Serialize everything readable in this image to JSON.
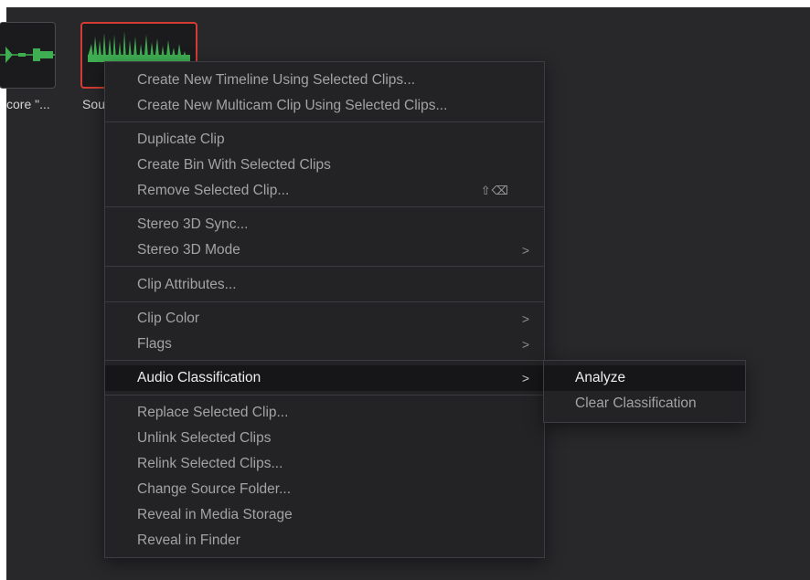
{
  "clips": [
    {
      "name": "core \"...",
      "selected": false
    },
    {
      "name": "Sou",
      "selected": true
    }
  ],
  "colors": {
    "waveform": "#3fae52",
    "selection": "#d23c34",
    "background": "#28282b"
  },
  "menu": {
    "items": [
      {
        "label": "Create New Timeline Using Selected Clips..."
      },
      {
        "label": "Create New Multicam Clip Using Selected Clips..."
      },
      {
        "label": "Duplicate Clip"
      },
      {
        "label": "Create Bin With Selected Clips"
      },
      {
        "label": "Remove Selected Clip...",
        "shortcut": "⇧⌫"
      },
      {
        "label": "Stereo 3D Sync..."
      },
      {
        "label": "Stereo 3D Mode",
        "submenu_icon": "chevron-right-icon",
        "arrow": ">"
      },
      {
        "label": "Clip Attributes..."
      },
      {
        "label": "Clip Color",
        "submenu_icon": "chevron-right-icon",
        "arrow": ">"
      },
      {
        "label": "Flags",
        "submenu_icon": "chevron-right-icon",
        "arrow": ">"
      },
      {
        "label": "Audio Classification",
        "submenu_icon": "chevron-right-icon",
        "arrow": ">",
        "active": true
      },
      {
        "label": "Replace Selected Clip..."
      },
      {
        "label": "Unlink Selected Clips"
      },
      {
        "label": "Relink Selected Clips..."
      },
      {
        "label": "Change Source Folder..."
      },
      {
        "label": "Reveal in Media Storage"
      },
      {
        "label": "Reveal in Finder"
      }
    ]
  },
  "submenu": {
    "items": [
      {
        "label": "Analyze",
        "active": true
      },
      {
        "label": "Clear Classification"
      }
    ]
  }
}
